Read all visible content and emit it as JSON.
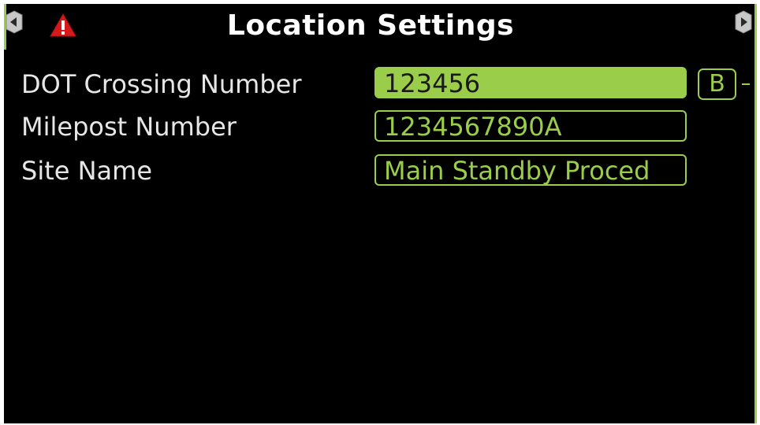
{
  "header": {
    "title": "Location Settings",
    "left_arrow_icon": "chevron-left-icon",
    "right_arrow_icon": "chevron-right-icon",
    "warning_icon": "warning-icon"
  },
  "fields": [
    {
      "label": "DOT Crossing Number",
      "value": "123456",
      "active": true,
      "badge": "B"
    },
    {
      "label": "Milepost Number",
      "value": "1234567890A",
      "active": false
    },
    {
      "label": "Site Name",
      "value": "Main Standby Proced",
      "active": false
    }
  ],
  "colors": {
    "accent": "#9acd4a",
    "background": "#000000",
    "label_text": "#e6e6e6",
    "warning": "#d7191c"
  }
}
